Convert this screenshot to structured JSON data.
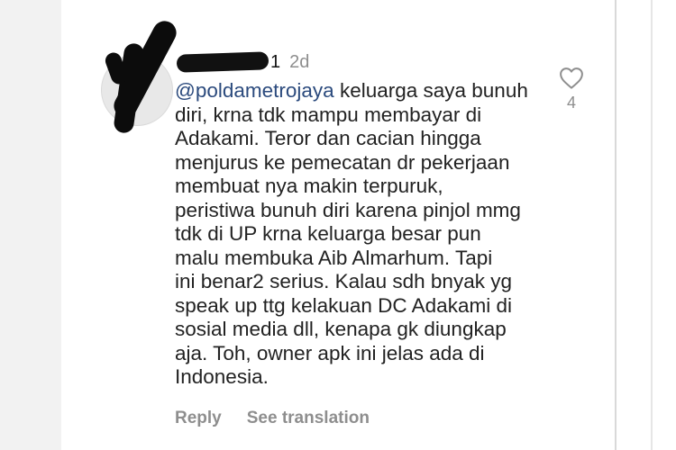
{
  "comment": {
    "username_visible_tail": "1",
    "time": "2d",
    "mention": "@poldametrojaya",
    "first_line_rest": " keluarga saya bunuh",
    "lines": [
      "diri, krna tdk mampu membayar di",
      "Adakami. Teror dan cacian hingga",
      "menjurus ke pemecatan dr pekerjaan",
      "membuat nya makin terpuruk,",
      "peristiwa bunuh diri karena pinjol mmg",
      "tdk di UP krna keluarga besar pun",
      "malu membuka Aib Almarhum. Tapi",
      "ini benar2 serius. Kalau sdh bnyak yg",
      "speak up ttg kelakuan DC Adakami di",
      "sosial media dll, kenapa gk diungkap",
      "aja. Toh, owner apk ini jelas ada di",
      "Indonesia."
    ],
    "like_count": "4",
    "reply_label": "Reply",
    "translate_label": "See translation"
  },
  "icons": {
    "like": "heart-icon"
  },
  "colors": {
    "text": "#222222",
    "muted": "#8e8e8e",
    "mention": "#2b4a7d"
  }
}
